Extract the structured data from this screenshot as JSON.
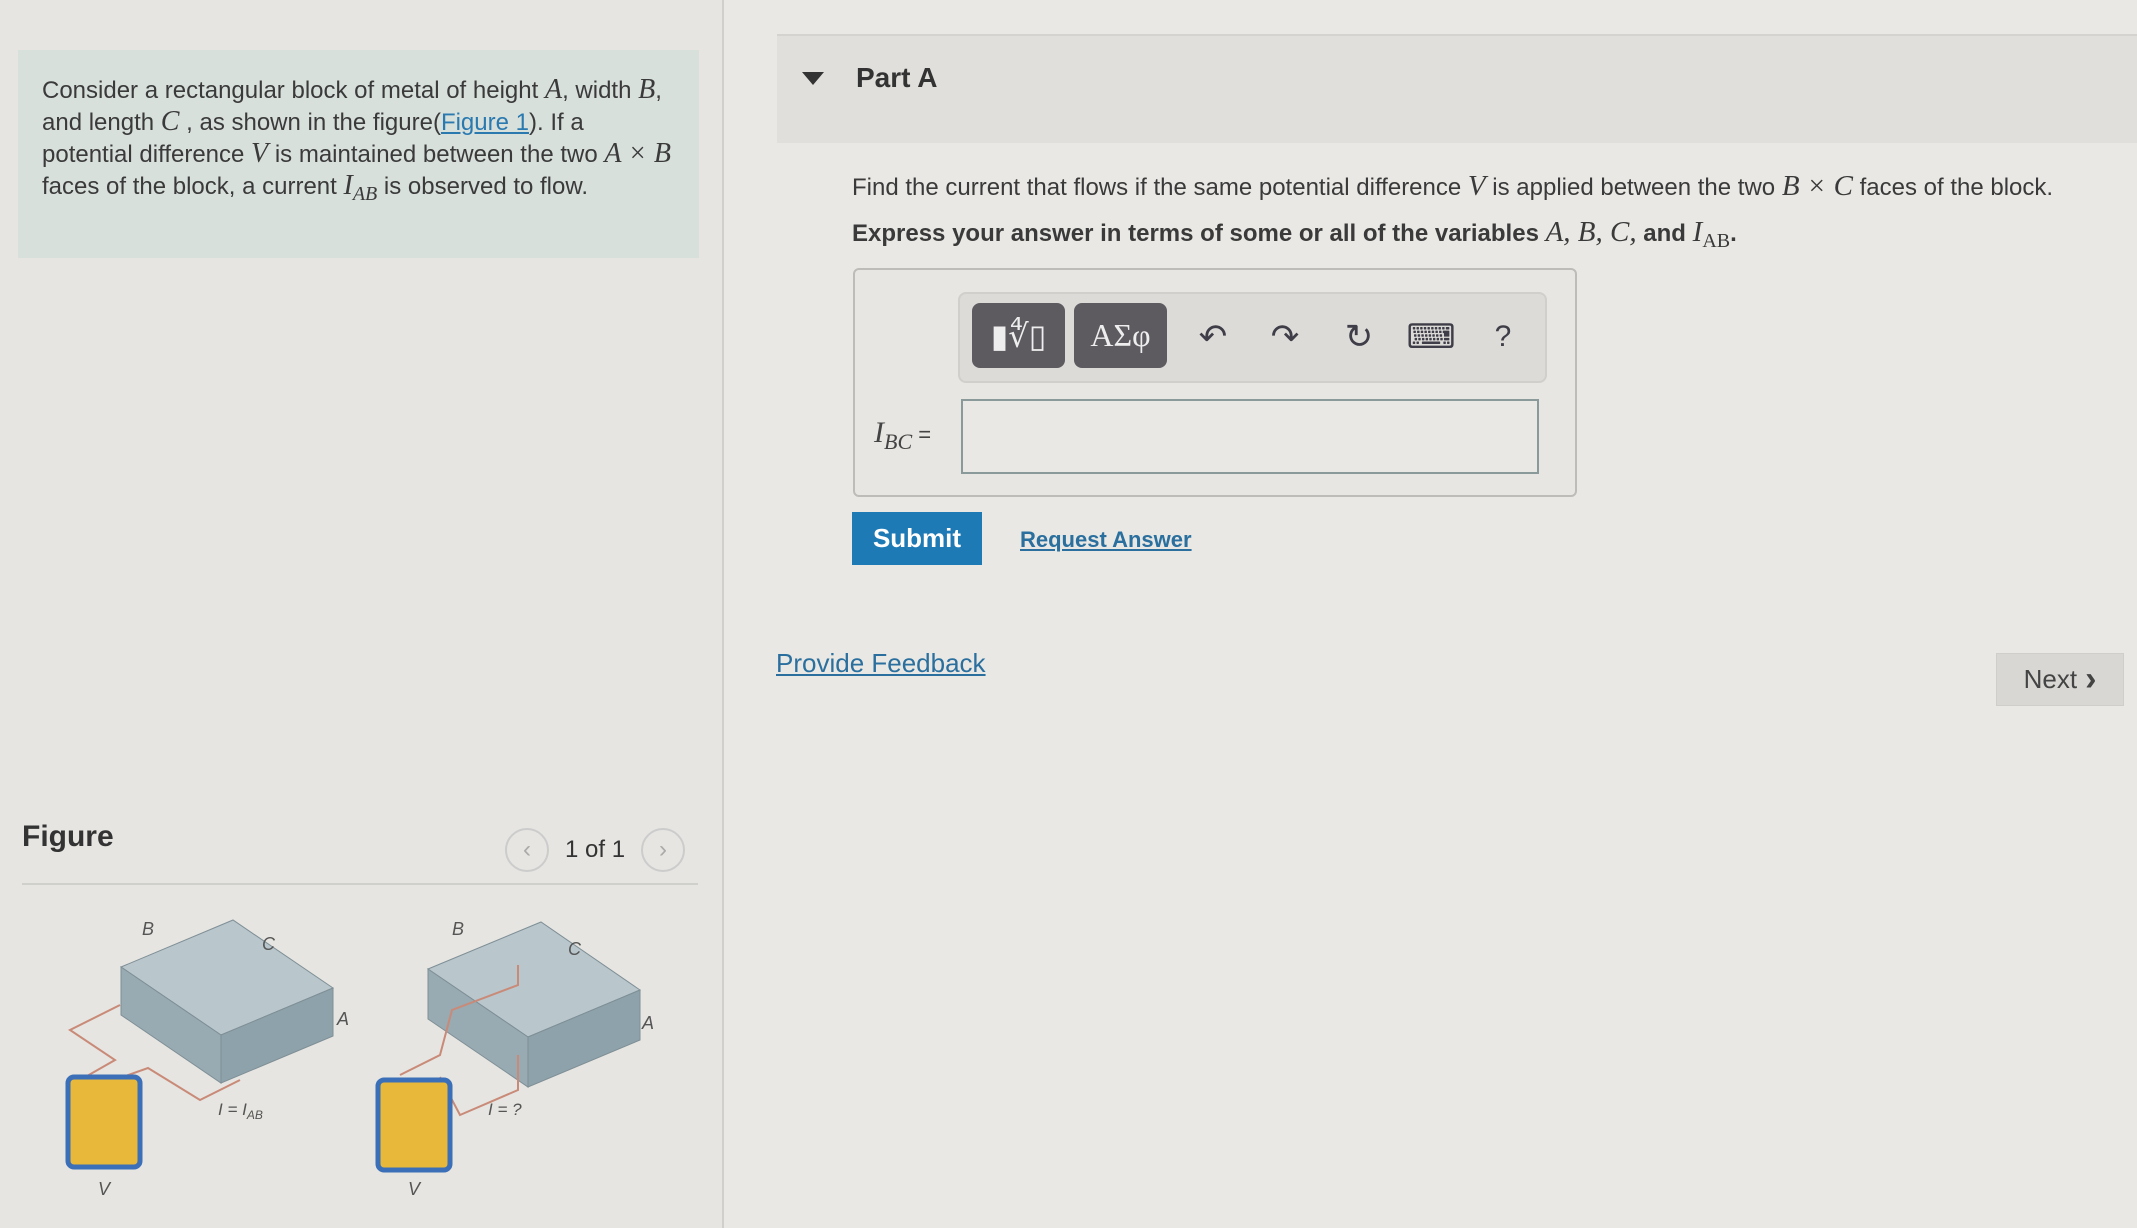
{
  "problem": {
    "t1": "Consider a rectangular block of metal of height ",
    "vA": "A",
    "t2": ", width ",
    "vB": "B",
    "t3": ", and length ",
    "vC": "C",
    "t4": " , as shown in the figure(",
    "link": "Figure 1",
    "t5": "). If a potential difference ",
    "vV": "V",
    "t6": " is maintained between the two ",
    "vAxB": "A × B",
    "t7": " faces of the block, a current ",
    "vI": "I",
    "vIsub": "AB",
    "t8": " is observed to flow."
  },
  "figure": {
    "title": "Figure",
    "pager": "1 of 1",
    "labels": {
      "B": "B",
      "C": "C",
      "A": "A",
      "V": "V",
      "i1": "I = I",
      "i1sub": "AB",
      "i2": "I = ?"
    }
  },
  "part": {
    "title": "Part A",
    "q1": "Find the current that flows if the same potential difference ",
    "qV": "V",
    "q2": " is applied between the two ",
    "qBxC": "B × C",
    "q3": " faces of the block.",
    "e1": "Express your answer in terms of some or all of the variables ",
    "evars": "A, B, C,",
    "e2": " and ",
    "eI": "I",
    "eIsub": "AB",
    "e3": "."
  },
  "toolbar": {
    "templates": "▮∜▯",
    "greek": "ΑΣφ",
    "undo": "↶",
    "redo": "↷",
    "reset": "↻",
    "keyboard": "⌨",
    "help": "?"
  },
  "answer": {
    "label": "I",
    "label_sub": "BC",
    "equals": " =",
    "value": ""
  },
  "buttons": {
    "submit": "Submit",
    "request": "Request Answer",
    "feedback": "Provide Feedback",
    "next": "Next",
    "next_icon": "›"
  }
}
